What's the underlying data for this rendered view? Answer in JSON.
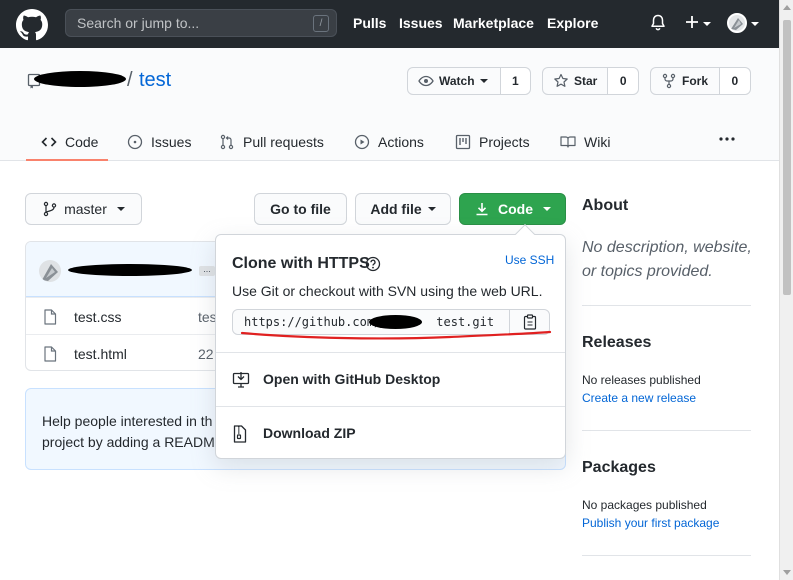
{
  "header": {
    "search_placeholder": "Search or jump to...",
    "search_shortcut": "/",
    "nav": [
      "Pulls",
      "Issues",
      "Marketplace",
      "Explore"
    ]
  },
  "repo": {
    "separator": "/",
    "name": "test",
    "watch": {
      "label": "Watch",
      "count": "1"
    },
    "star": {
      "label": "Star",
      "count": "0"
    },
    "fork": {
      "label": "Fork",
      "count": "0"
    },
    "tabs": [
      "Code",
      "Issues",
      "Pull requests",
      "Actions",
      "Projects",
      "Wiki"
    ]
  },
  "toolbar": {
    "branch": "master",
    "go_to_file": "Go to file",
    "add_file": "Add file",
    "code": "Code"
  },
  "files": [
    {
      "name": "test.css",
      "message": "tes"
    },
    {
      "name": "test.html",
      "message": "22"
    }
  ],
  "commit": {
    "ellipsis": "..."
  },
  "readme_prompt": {
    "line1": "Help people interested in th",
    "line2": "project by adding a READM"
  },
  "clone": {
    "title": "Clone with HTTPS",
    "use_ssh": "Use SSH",
    "description": "Use Git or checkout with SVN using the web URL.",
    "url_prefix": "https://github.com/",
    "url_suffix": "test.git",
    "desktop": "Open with GitHub Desktop",
    "zip": "Download ZIP"
  },
  "sidebar": {
    "about_title": "About",
    "about_desc": "No description, website, or topics provided.",
    "releases_title": "Releases",
    "releases_text": "No releases published",
    "releases_link": "Create a new release",
    "packages_title": "Packages",
    "packages_text": "No packages published",
    "packages_link": "Publish your first package"
  },
  "colors": {
    "header_bg": "#24292e",
    "green_button": "#2ea44f",
    "link": "#0366d6",
    "tab_underline": "#f9826c",
    "annotation_red": "#e02020"
  }
}
